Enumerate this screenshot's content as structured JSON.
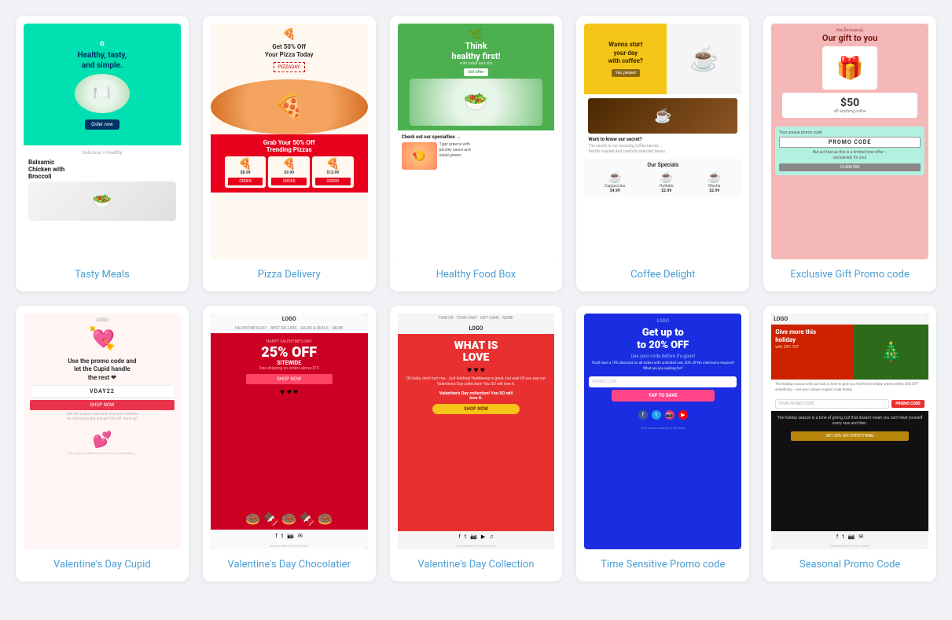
{
  "cards": [
    {
      "id": "tasty-meals",
      "label": "Tasty Meals",
      "template": "tasty"
    },
    {
      "id": "pizza-delivery",
      "label": "Pizza Delivery",
      "template": "pizza"
    },
    {
      "id": "healthy-food-box",
      "label": "Healthy Food Box",
      "template": "healthy"
    },
    {
      "id": "coffee-delight",
      "label": "Coffee Delight",
      "template": "coffee"
    },
    {
      "id": "exclusive-gift-promo",
      "label": "Exclusive Gift Promo code",
      "template": "gift"
    },
    {
      "id": "valentines-cupid",
      "label": "Valentine's Day Cupid",
      "template": "vcupid"
    },
    {
      "id": "valentines-chocolatier",
      "label": "Valentine's Day Chocolatier",
      "template": "vchoc"
    },
    {
      "id": "valentines-collection",
      "label": "Valentine's Day Collection",
      "template": "vcoll"
    },
    {
      "id": "time-sensitive-promo",
      "label": "Time Sensitive Promo code",
      "template": "tspromo"
    },
    {
      "id": "seasonal-promo",
      "label": "Seasonal Promo Code",
      "template": "seasonal"
    }
  ]
}
